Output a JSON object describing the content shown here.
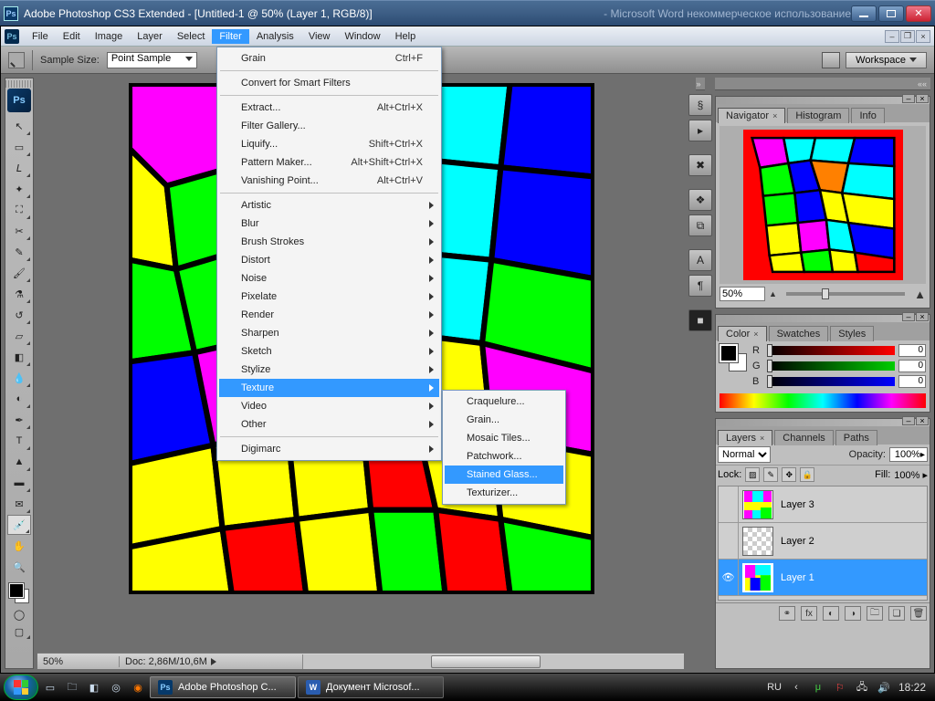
{
  "window": {
    "title": "Adobe Photoshop CS3 Extended - [Untitled-1 @ 50% (Layer 1, RGB/8)]",
    "ghosted_bg_window": "          -   Microsoft Word некоммерческое использование"
  },
  "menubar": {
    "items": [
      "File",
      "Edit",
      "Image",
      "Layer",
      "Select",
      "Filter",
      "Analysis",
      "View",
      "Window",
      "Help"
    ],
    "active_index": 5
  },
  "optionsbar": {
    "sample_size_label": "Sample Size:",
    "sample_size_value": "Point Sample",
    "workspace_label": "Workspace"
  },
  "filter_menu": {
    "last": {
      "label": "Grain",
      "shortcut": "Ctrl+F"
    },
    "convert": "Convert for Smart Filters",
    "group2": [
      {
        "label": "Extract...",
        "shortcut": "Alt+Ctrl+X"
      },
      {
        "label": "Filter Gallery...",
        "shortcut": ""
      },
      {
        "label": "Liquify...",
        "shortcut": "Shift+Ctrl+X"
      },
      {
        "label": "Pattern Maker...",
        "shortcut": "Alt+Shift+Ctrl+X"
      },
      {
        "label": "Vanishing Point...",
        "shortcut": "Alt+Ctrl+V"
      }
    ],
    "submenus": [
      "Artistic",
      "Blur",
      "Brush Strokes",
      "Distort",
      "Noise",
      "Pixelate",
      "Render",
      "Sharpen",
      "Sketch",
      "Stylize",
      "Texture",
      "Video",
      "Other"
    ],
    "submenu_highlight_index": 10,
    "digimarc": "Digimarc",
    "texture_sub": [
      "Craquelure...",
      "Grain...",
      "Mosaic Tiles...",
      "Patchwork...",
      "Stained Glass...",
      "Texturizer..."
    ],
    "texture_sub_highlight_index": 4
  },
  "status": {
    "zoom": "50%",
    "docsize": "Doc: 2,86M/10,6M"
  },
  "navigator": {
    "tabs": [
      "Navigator",
      "Histogram",
      "Info"
    ],
    "active_tab": 0,
    "zoom_value": "50%"
  },
  "color": {
    "tabs": [
      "Color",
      "Swatches",
      "Styles"
    ],
    "active_tab": 0,
    "channels": {
      "R": "0",
      "G": "0",
      "B": "0"
    }
  },
  "layers": {
    "tabs": [
      "Layers",
      "Channels",
      "Paths"
    ],
    "active_tab": 0,
    "blend_mode": "Normal",
    "opacity_label": "Opacity:",
    "opacity": "100%",
    "lock_label": "Lock:",
    "fill_label": "Fill:",
    "fill": "100%",
    "list": [
      {
        "name": "Layer 3",
        "visible": false,
        "thumb": "stained",
        "selected": false
      },
      {
        "name": "Layer 2",
        "visible": false,
        "thumb": "checker",
        "selected": false
      },
      {
        "name": "Layer 1",
        "visible": true,
        "thumb": "stained",
        "selected": true
      }
    ]
  },
  "taskbar": {
    "app1": "Adobe Photoshop C...",
    "app2": "Документ Microsof...",
    "lang": "RU",
    "time": "18:22"
  }
}
